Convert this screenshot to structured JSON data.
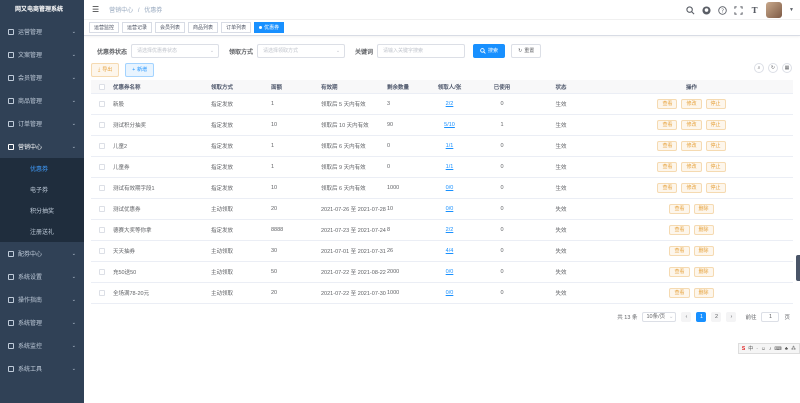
{
  "app_title": "网又电商管理系统",
  "sidebar": {
    "items": [
      {
        "label": "运营管理",
        "icon": "operation-icon"
      },
      {
        "label": "文案管理",
        "icon": "doc-icon"
      },
      {
        "label": "会员管理",
        "icon": "user-icon"
      },
      {
        "label": "商品管理",
        "icon": "goods-icon"
      },
      {
        "label": "订单管理",
        "icon": "order-icon"
      },
      {
        "label": "营销中心",
        "icon": "marketing-icon"
      }
    ],
    "sub_items": [
      "优惠券",
      "电子券",
      "积分抽奖",
      "注册送礼"
    ],
    "items_after": [
      {
        "label": "配券中心",
        "icon": "coupon-center-icon"
      },
      {
        "label": "系统设置",
        "icon": "settings-icon"
      },
      {
        "label": "操作指南",
        "icon": "guide-icon"
      },
      {
        "label": "系统管理",
        "icon": "system-icon"
      },
      {
        "label": "系统监控",
        "icon": "monitor-icon"
      },
      {
        "label": "系统工具",
        "icon": "tools-icon"
      }
    ]
  },
  "breadcrumb": {
    "parent": "营销中心",
    "sep": "/",
    "current": "优惠券"
  },
  "tags": [
    "运营监控",
    "运营记录",
    "会员列表",
    "商品列表",
    "订单列表",
    "优惠券"
  ],
  "search": {
    "label1": "优惠券状态",
    "placeholder1": "请选择优惠券状态",
    "label2": "领取方式",
    "placeholder2": "请选择领取方式",
    "label3": "关键词",
    "placeholder3": "请输入关键字搜索",
    "search_btn": "搜索",
    "reset_btn": "重置"
  },
  "toolbar": {
    "export_btn": "导出",
    "add_btn": "新增"
  },
  "columns": [
    "优惠券名称",
    "领取方式",
    "面额",
    "有效期",
    "剩余数量",
    "领取人/张",
    "已使用",
    "状态",
    "操作"
  ],
  "rows": [
    {
      "name": "新股",
      "way": "指定发放",
      "amount": "1",
      "validity": "领取后 5 天内有效",
      "remain": "3",
      "claim": "2/2",
      "used": "0",
      "status": "生效",
      "actions": [
        "查看",
        "修改",
        "停止"
      ]
    },
    {
      "name": "测试积分抽奖",
      "way": "指定发放",
      "amount": "10",
      "validity": "领取后 10 天内有效",
      "remain": "90",
      "claim": "5/10",
      "used": "1",
      "status": "生效",
      "actions": [
        "查看",
        "修改",
        "停止"
      ]
    },
    {
      "name": "儿童2",
      "way": "指定发放",
      "amount": "1",
      "validity": "领取后 6 天内有效",
      "remain": "0",
      "claim": "1/1",
      "used": "0",
      "status": "生效",
      "actions": [
        "查看",
        "修改",
        "停止"
      ]
    },
    {
      "name": "儿童券",
      "way": "指定发放",
      "amount": "1",
      "validity": "领取后 9 天内有效",
      "remain": "0",
      "claim": "1/1",
      "used": "0",
      "status": "生效",
      "actions": [
        "查看",
        "修改",
        "停止"
      ]
    },
    {
      "name": "测试有效期字段1",
      "way": "指定发放",
      "amount": "10",
      "validity": "领取后 6 天内有效",
      "remain": "1000",
      "claim": "0/0",
      "used": "0",
      "status": "生效",
      "actions": [
        "查看",
        "修改",
        "停止"
      ]
    },
    {
      "name": "测试优惠券",
      "way": "主动领取",
      "amount": "20",
      "validity": "2021-07-26 至 2021-07-28",
      "remain": "10",
      "claim": "0/0",
      "used": "0",
      "status": "失效",
      "actions": [
        "查看",
        "删除"
      ]
    },
    {
      "name": "德赛大奖等你拿",
      "way": "指定发放",
      "amount": "8888",
      "validity": "2021-07-23 至 2021-07-24",
      "remain": "8",
      "claim": "2/2",
      "used": "0",
      "status": "失效",
      "actions": [
        "查看",
        "删除"
      ]
    },
    {
      "name": "天天抽券",
      "way": "主动领取",
      "amount": "30",
      "validity": "2021-07-01 至 2021-07-31",
      "remain": "26",
      "claim": "4/4",
      "used": "0",
      "status": "失效",
      "actions": [
        "查看",
        "删除"
      ]
    },
    {
      "name": "充50送50",
      "way": "主动领取",
      "amount": "50",
      "validity": "2021-07-22 至 2021-08-22",
      "remain": "2000",
      "claim": "0/0",
      "used": "0",
      "status": "失效",
      "actions": [
        "查看",
        "删除"
      ]
    },
    {
      "name": "全场满78-20元",
      "way": "主动领取",
      "amount": "20",
      "validity": "2021-07-22 至 2021-07-30",
      "remain": "1000",
      "claim": "0/0",
      "used": "0",
      "status": "失效",
      "actions": [
        "查看",
        "删除"
      ]
    }
  ],
  "pagination": {
    "total": "共 13 条",
    "page_size": "10条/页",
    "pages": [
      "1",
      "2"
    ],
    "current": "1",
    "jump_label": "前往",
    "jump_value": "1",
    "jump_suffix": "页"
  },
  "colors": {
    "sidebar_bg": "#304156",
    "primary": "#1890ff",
    "warning": "#e6a23c"
  }
}
